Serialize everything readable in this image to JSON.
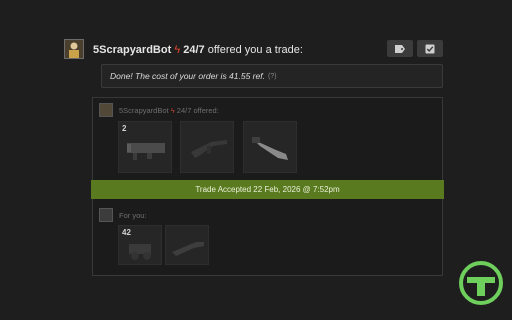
{
  "header": {
    "sender_name": "5ScrapyardBot",
    "sender_tag": "24/7",
    "action_text": "offered you a trade:"
  },
  "message": {
    "text": "Done! The cost of your order is 41.55 ref.",
    "help": "(?)"
  },
  "their_side": {
    "name": "5ScrapyardBot",
    "tag": "24/7",
    "label": "offered:",
    "items": [
      {
        "name": "rocket-launcher-item",
        "quantity": "2"
      },
      {
        "name": "shotgun-item",
        "quantity": ""
      },
      {
        "name": "knife-item",
        "quantity": ""
      }
    ]
  },
  "status": {
    "text": "Trade Accepted 22 Feb, 2026 @ 7:52pm",
    "color": "#5a7a1f"
  },
  "your_side": {
    "label": "For you:",
    "items": [
      {
        "name": "refined-metal-item",
        "quantity": "42"
      },
      {
        "name": "weapon-item",
        "quantity": ""
      }
    ]
  },
  "colors": {
    "background": "#1e1e1e",
    "accent_bolt": "#e0462a",
    "accepted_green": "#5a7a1f",
    "logo_green": "#6fcf5c"
  }
}
